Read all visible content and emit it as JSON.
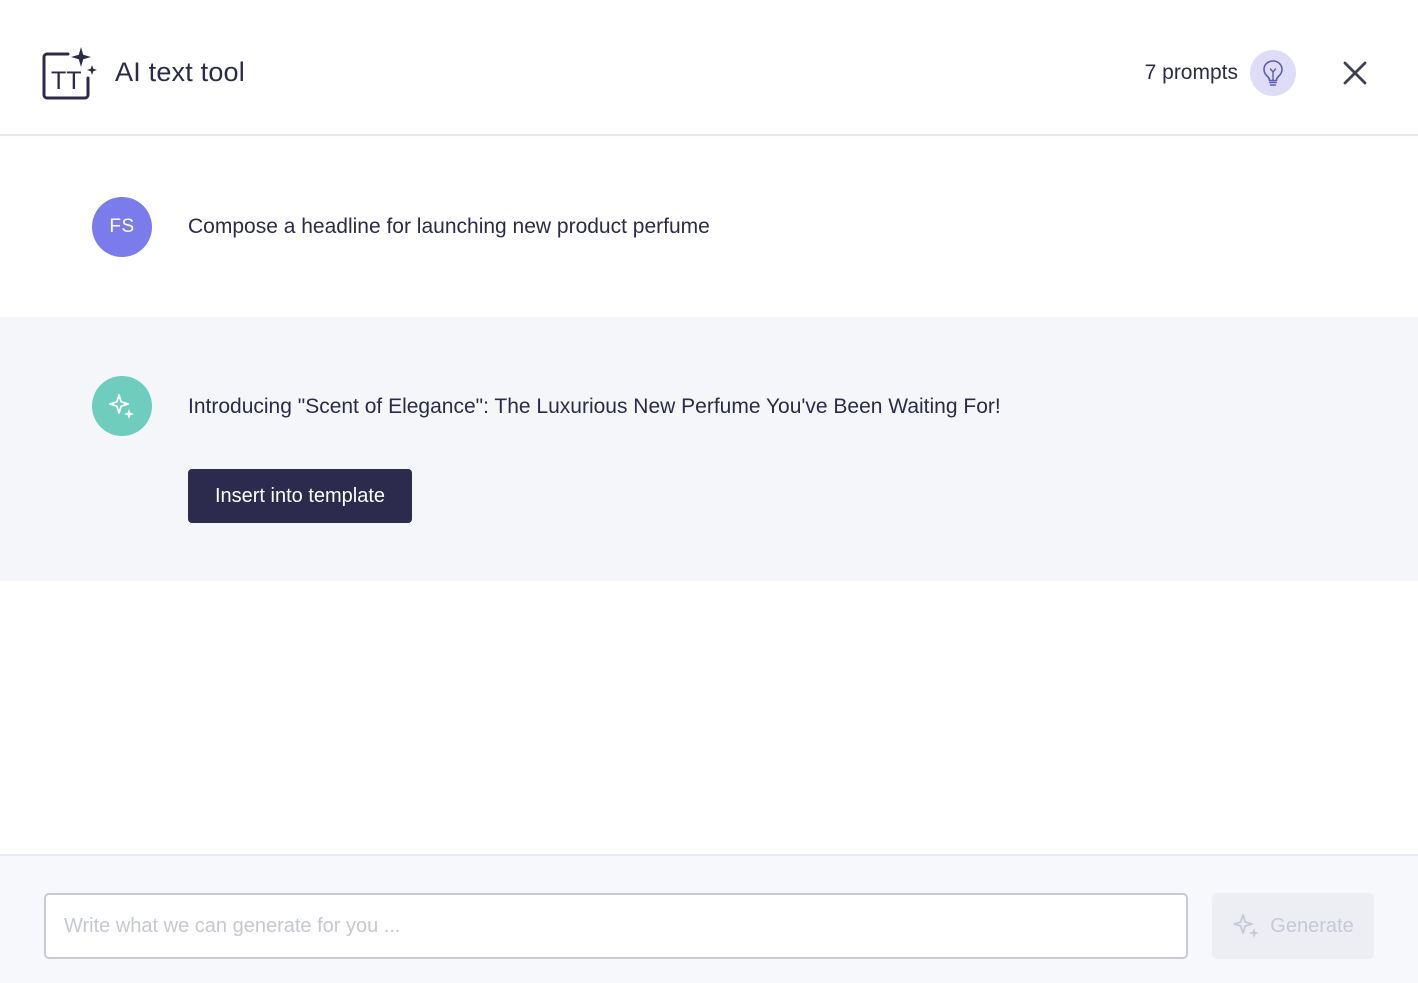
{
  "header": {
    "title": "AI text tool",
    "tool_icon": "text-sparkle-icon",
    "tool_icon_text": "TT",
    "prompts_count": "7 prompts",
    "bulb_icon": "lightbulb-icon",
    "close_icon": "close-icon"
  },
  "conversation": {
    "user_message": {
      "avatar_initials": "FS",
      "avatar_color": "#7b7bec",
      "text": "Compose a headline for launching new product perfume"
    },
    "ai_message": {
      "avatar_icon": "sparkle-icon",
      "avatar_color": "#6ecdbd",
      "text": "Introducing \"Scent of Elegance\": The Luxurious New Perfume You've Been Waiting For!",
      "insert_button_label": "Insert into template"
    }
  },
  "composer": {
    "input_value": "",
    "input_placeholder": "Write what we can generate for you ...",
    "generate_label": "Generate",
    "generate_icon": "sparkle-icon",
    "generate_enabled": false
  },
  "colors": {
    "primary_dark": "#2c2b4e",
    "text": "#2b2b48",
    "ai_row_bg": "#f5f6fa",
    "bulb_bg": "#dedcf7"
  }
}
